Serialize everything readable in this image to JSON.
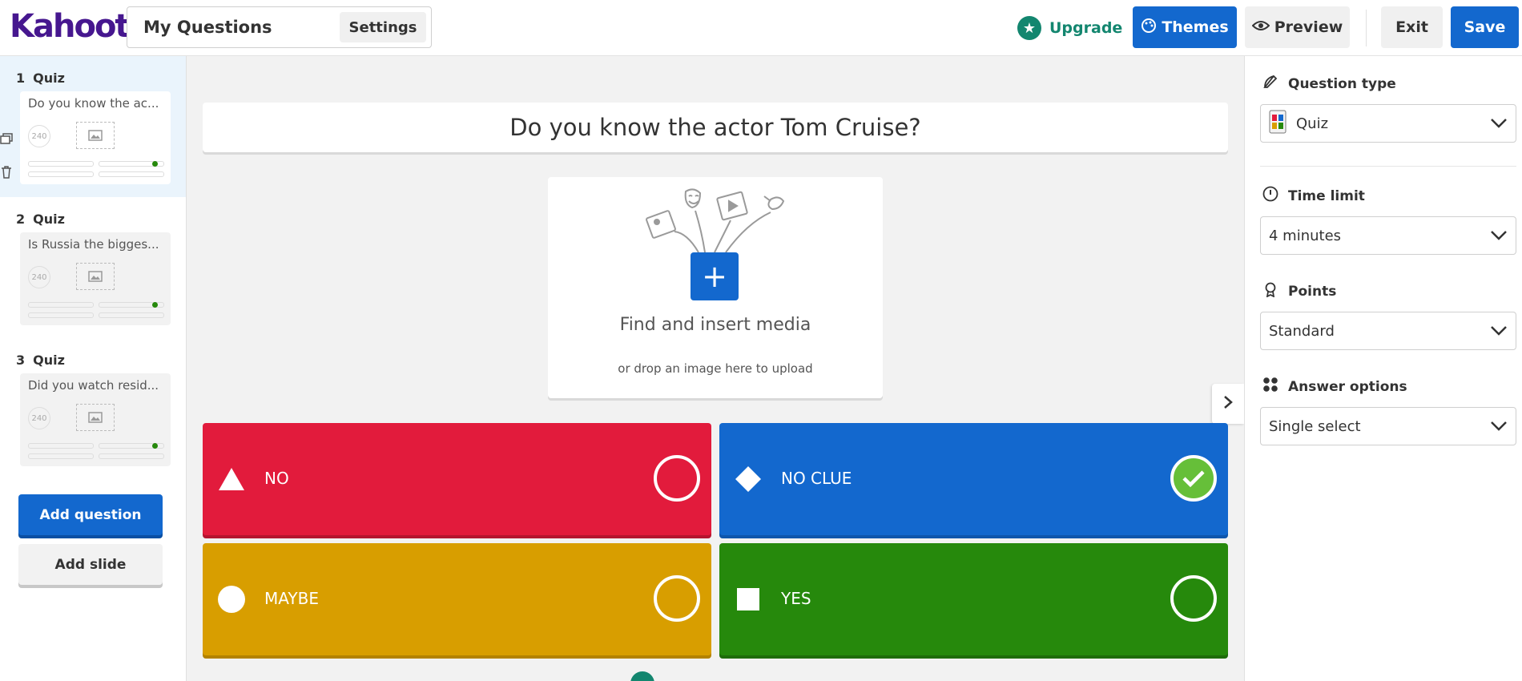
{
  "header": {
    "logo": "Kahoot!",
    "title": "My Questions",
    "settings_label": "Settings",
    "upgrade_label": "Upgrade",
    "themes_label": "Themes",
    "preview_label": "Preview",
    "exit_label": "Exit",
    "save_label": "Save"
  },
  "sidebar": {
    "slides": [
      {
        "number": "1",
        "type": "Quiz",
        "question": "Do you know the ac...",
        "time": "240"
      },
      {
        "number": "2",
        "type": "Quiz",
        "question": "Is Russia the bigges...",
        "time": "240"
      },
      {
        "number": "3",
        "type": "Quiz",
        "question": "Did you watch resid...",
        "time": "240"
      }
    ],
    "add_question_label": "Add question",
    "add_slide_label": "Add slide"
  },
  "editor": {
    "question": "Do you know the actor Tom Cruise?",
    "media_title": "Find and insert media",
    "media_subtitle": "or drop an image here to upload",
    "answers": [
      {
        "text": "NO",
        "shape": "triangle-icon",
        "color": "#e21b3c",
        "correct": false
      },
      {
        "text": "NO CLUE",
        "shape": "diamond-icon",
        "color": "#1368ce",
        "correct": true
      },
      {
        "text": "MAYBE",
        "shape": "circle-icon",
        "color": "#d89e00",
        "correct": false
      },
      {
        "text": "YES",
        "shape": "square-icon",
        "color": "#26890c",
        "correct": false
      }
    ]
  },
  "settings_panel": {
    "question_type_label": "Question type",
    "question_type_value": "Quiz",
    "time_limit_label": "Time limit",
    "time_limit_value": "4 minutes",
    "points_label": "Points",
    "points_value": "Standard",
    "answer_options_label": "Answer options",
    "answer_options_value": "Single select"
  },
  "colors": {
    "brand_purple": "#46178f",
    "primary_blue": "#1368ce",
    "upgrade_teal": "#13866f",
    "correct_green": "#66bf39"
  }
}
